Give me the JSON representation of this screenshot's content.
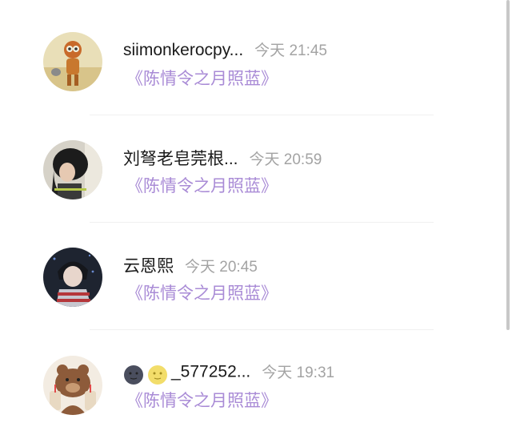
{
  "messages": [
    {
      "username": "siimonkerocpy...",
      "time": "今天 21:45",
      "content": "《陈情令之月照蓝》",
      "avatar": "cartoon-character-desert"
    },
    {
      "username": "刘弩老皂莞根...",
      "time": "今天 20:59",
      "content": "《陈情令之月照蓝》",
      "avatar": "girl-hood-profile"
    },
    {
      "username": "云恩熙",
      "time": "今天 20:45",
      "content": "《陈情令之月照蓝》",
      "avatar": "anime-boy-striped-shirt"
    },
    {
      "username": "_577252...",
      "username_prefix_emoji": [
        "new-moon-face",
        "full-moon-face"
      ],
      "time": "今天 19:31",
      "content": "《陈情令之月照蓝》",
      "avatar": "bear-bubble-tea"
    }
  ],
  "colors": {
    "content_purple": "#a98bd6",
    "timestamp_gray": "#a3a3a3",
    "username_black": "#1a1a1a"
  }
}
